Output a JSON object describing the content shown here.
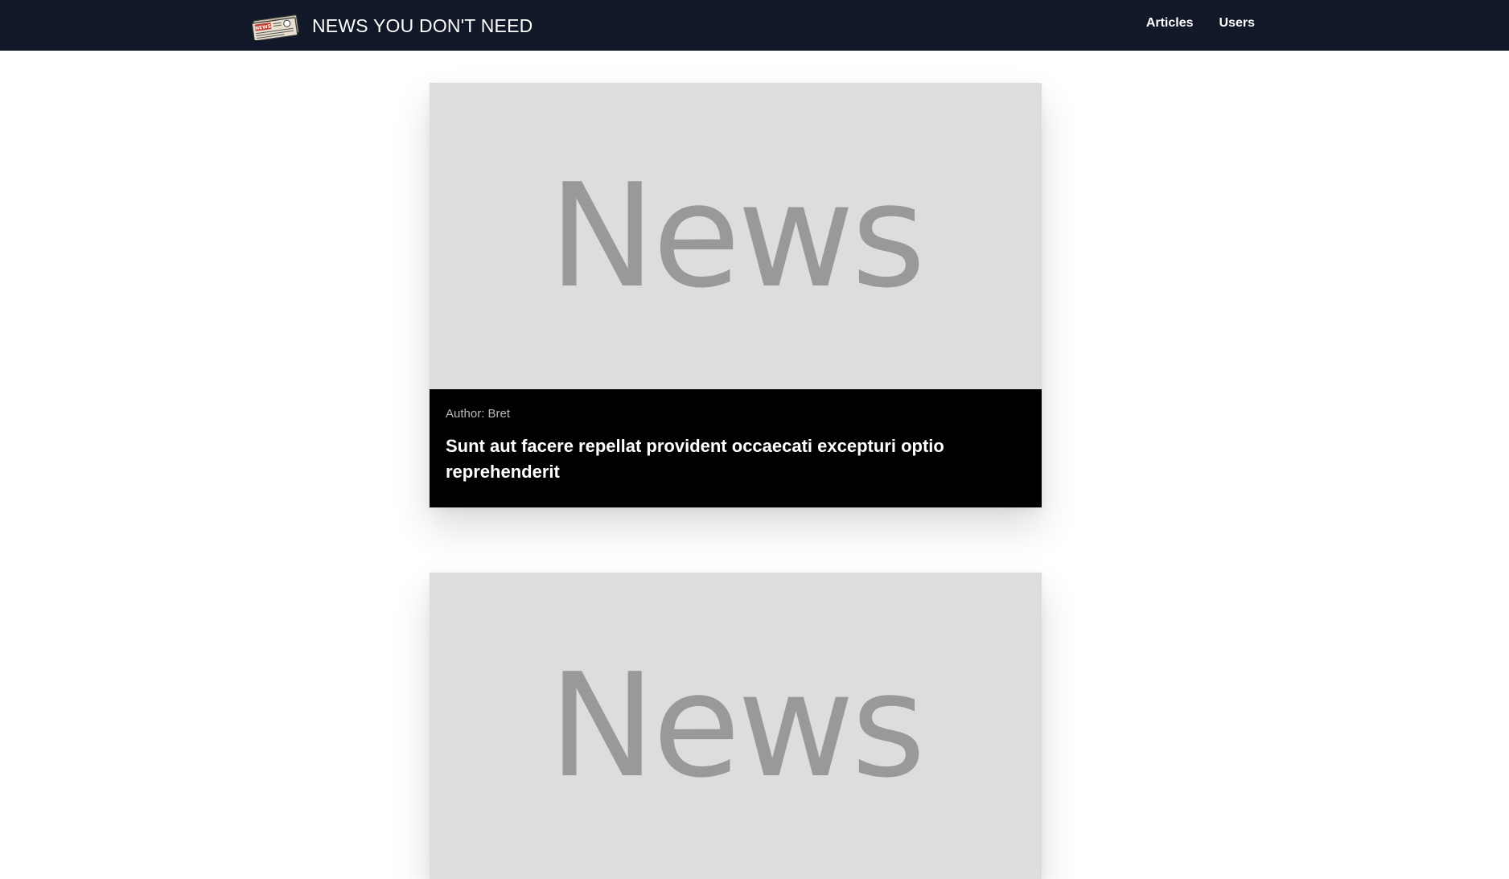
{
  "header": {
    "logo_icon": "newspaper-icon",
    "logo_badge_text": "NEWS",
    "title": "NEWS YOU DON'T NEED",
    "nav": [
      {
        "label": "Articles"
      },
      {
        "label": "Users"
      }
    ]
  },
  "articles": [
    {
      "image_text": "News",
      "author": "Author: Bret",
      "title": "Sunt aut facere repellat provident occaecati excepturi optio reprehenderit"
    },
    {
      "image_text": "News"
    }
  ],
  "colors": {
    "navbar_bg": "#111827",
    "card_image_bg": "#dddddd",
    "card_image_text": "#999999",
    "card_body_bg": "#000000"
  }
}
